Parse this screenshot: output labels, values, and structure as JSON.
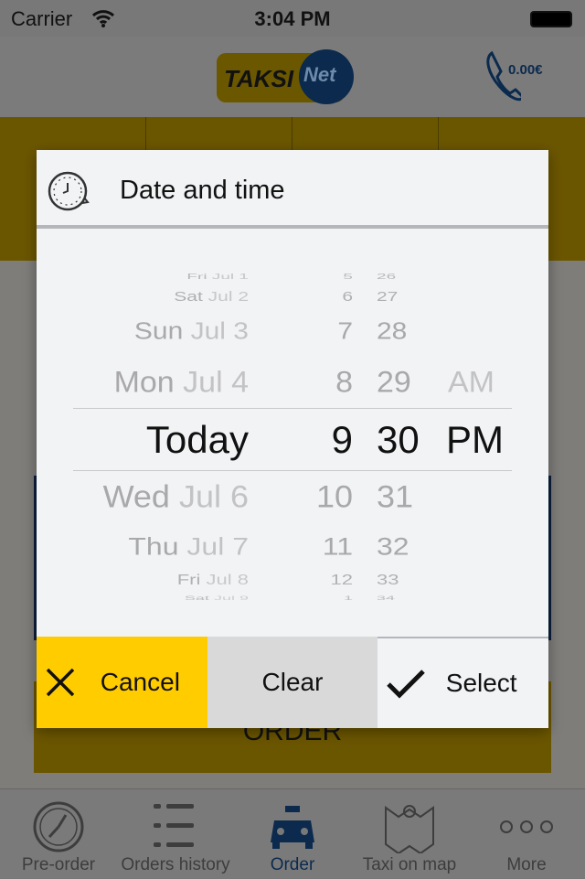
{
  "status": {
    "carrier": "Carrier",
    "time": "3:04 PM"
  },
  "header": {
    "logo_text": [
      "TAKSI",
      "Net"
    ],
    "balance": "0.00€"
  },
  "dialog": {
    "title": "Date and time",
    "picker": {
      "dates": [
        {
          "label": "Fri Jul 1",
          "day": "Fri",
          "md": "Jul 1"
        },
        {
          "label": "Sat Jul 2",
          "day": "Sat",
          "md": "Jul 2"
        },
        {
          "label": "Sun Jul 3",
          "day": "Sun",
          "md": "Jul 3"
        },
        {
          "label": "Mon Jul 4",
          "day": "Mon",
          "md": "Jul 4"
        },
        {
          "label": "Today",
          "day": "Today",
          "md": ""
        },
        {
          "label": "Wed Jul 6",
          "day": "Wed",
          "md": "Jul 6"
        },
        {
          "label": "Thu Jul 7",
          "day": "Thu",
          "md": "Jul 7"
        },
        {
          "label": "Fri Jul 8",
          "day": "Fri",
          "md": "Jul 8"
        },
        {
          "label": "Sat Jul 9",
          "day": "Sat",
          "md": "Jul 9"
        }
      ],
      "hours": [
        "5",
        "6",
        "7",
        "8",
        "9",
        "10",
        "11",
        "12",
        "1"
      ],
      "minutes": [
        "26",
        "27",
        "28",
        "29",
        "30",
        "31",
        "32",
        "33",
        "34"
      ],
      "ampm": [
        "AM",
        "PM"
      ],
      "selected": {
        "date": "Today",
        "hour": "9",
        "minute": "30",
        "ampm": "PM"
      }
    },
    "buttons": {
      "cancel": "Cancel",
      "clear": "Clear",
      "select": "Select"
    }
  },
  "background": {
    "order_button": "ORDER"
  },
  "tabs": [
    {
      "label": "Pre-order",
      "icon": "clock-icon"
    },
    {
      "label": "Orders history",
      "icon": "list-icon"
    },
    {
      "label": "Order",
      "icon": "taxi-icon",
      "active": true
    },
    {
      "label": "Taxi on map",
      "icon": "map-pin-icon"
    },
    {
      "label": "More",
      "icon": "more-icon"
    }
  ],
  "colors": {
    "accent_yellow": "#ffcc00",
    "brand_blue": "#0a3d7a",
    "clear_bg": "#d9d9d9"
  }
}
